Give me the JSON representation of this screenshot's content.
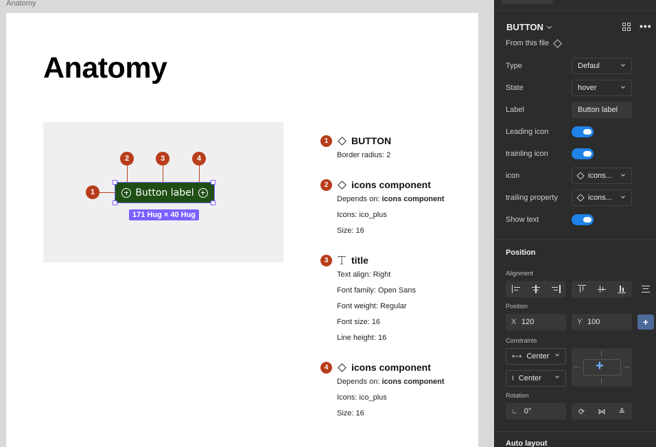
{
  "canvas": {
    "frame_label": "Anatomy",
    "page_title": "Anatomy",
    "preview": {
      "button_label": "Button label",
      "size_badge": "171 Hug × 40 Hug",
      "markers": [
        "1",
        "2",
        "3",
        "4"
      ]
    },
    "anatomy": [
      {
        "num": "1",
        "icon": "diamond-icon",
        "title": "BUTTON",
        "props": [
          {
            "key": "Border radius:",
            "value": "2",
            "bold": false
          }
        ]
      },
      {
        "num": "2",
        "icon": "diamond-icon",
        "title": "icons component",
        "props": [
          {
            "key": "Depends on:",
            "value": "icons component",
            "bold": true
          },
          {
            "key": "Icons:",
            "value": "ico_plus",
            "bold": false
          },
          {
            "key": "Size:",
            "value": "16",
            "bold": false
          }
        ]
      },
      {
        "num": "3",
        "icon": "text-icon",
        "title": "title",
        "props": [
          {
            "key": "Text align:",
            "value": "Right",
            "bold": false
          },
          {
            "key": "Font family:",
            "value": "Open Sans",
            "bold": false
          },
          {
            "key": "Font weight:",
            "value": "Regular",
            "bold": false
          },
          {
            "key": "Font size:",
            "value": "16",
            "bold": false
          },
          {
            "key": "Line height:",
            "value": "16",
            "bold": false
          }
        ]
      },
      {
        "num": "4",
        "icon": "diamond-icon",
        "title": "icons component",
        "props": [
          {
            "key": "Depends on:",
            "value": "icons component",
            "bold": true
          },
          {
            "key": "Icons:",
            "value": "ico_plus",
            "bold": false
          },
          {
            "key": "Size:",
            "value": "16",
            "bold": false
          }
        ]
      }
    ]
  },
  "panel": {
    "component_name": "BUTTON",
    "from_file": "From this file",
    "properties": [
      {
        "label": "Type",
        "kind": "select",
        "value": "Defaul"
      },
      {
        "label": "State",
        "kind": "select",
        "value": "hover"
      },
      {
        "label": "Label",
        "kind": "text",
        "value": "Button label"
      },
      {
        "label": "Leading icon",
        "kind": "toggle",
        "value": "on"
      },
      {
        "label": "trainling icon",
        "kind": "toggle",
        "value": "on"
      },
      {
        "label": "icon",
        "kind": "instance",
        "value": "icons..."
      },
      {
        "label": "trailing property",
        "kind": "instance",
        "value": "icons..."
      },
      {
        "label": "Show text",
        "kind": "toggle",
        "value": "on"
      }
    ],
    "position": {
      "title": "Position",
      "alignment_label": "Alignment",
      "position_label": "Position",
      "x_key": "X",
      "x_value": "120",
      "y_key": "Y",
      "y_value": "100",
      "constraints_label": "Constraints",
      "constraint_h": "Center",
      "constraint_v": "Center",
      "rotation_label": "Rotation",
      "rotation_value": "0°"
    },
    "auto_layout": "Auto layout"
  },
  "colors": {
    "marker": "#b83d1a",
    "selection": "#7b61ff",
    "button_fill": "#1f4f15",
    "toggle_on": "#1f83e8",
    "panel_bg": "#2c2c2c"
  }
}
